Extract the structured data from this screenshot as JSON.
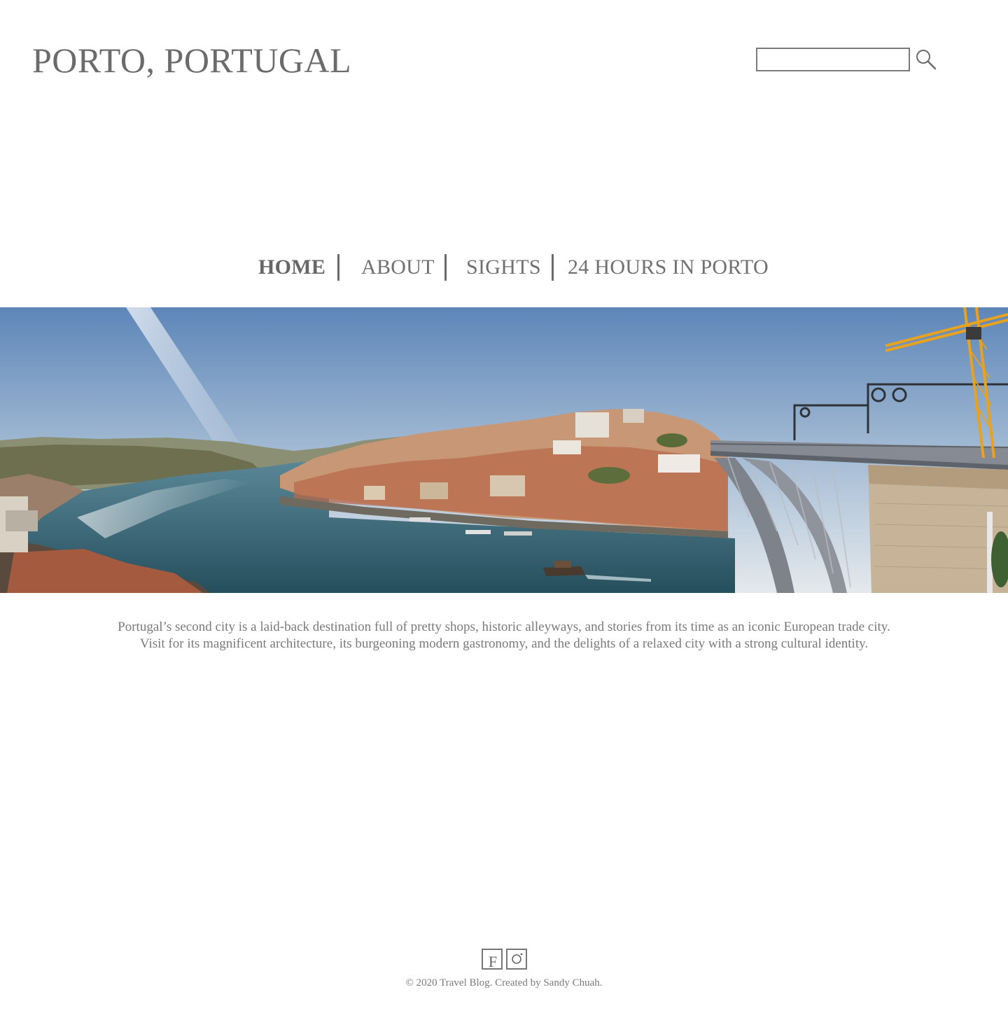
{
  "header": {
    "site_title": "PORTO, PORTUGAL",
    "search": {
      "placeholder": "",
      "value": "",
      "button_icon": "search-icon"
    }
  },
  "nav": {
    "items": [
      {
        "label": "HOME",
        "active": true
      },
      {
        "label": "ABOUT",
        "active": false
      },
      {
        "label": "SIGHTS",
        "active": false
      },
      {
        "label": "24 HOURS IN PORTO",
        "active": false
      }
    ]
  },
  "hero": {
    "description": "Panoramic photo of the Douro river in Porto with the Dom Luís I bridge and a yellow crane"
  },
  "intro": {
    "text": "Portugal’s second city is a laid-back destination full of pretty shops, historic alleyways, and stories from its time as an iconic European trade city. Visit for its magnificent architecture, its burgeoning modern gastronomy, and the delights of a relaxed city with a strong cultural identity."
  },
  "footer": {
    "social": [
      {
        "name": "facebook",
        "icon": "facebook-icon",
        "glyph": "F"
      },
      {
        "name": "instagram",
        "icon": "instagram-icon"
      }
    ],
    "copyright": "© 2020 Travel Blog.  Created by Sandy Chuah."
  },
  "colors": {
    "text": "#6b6b6b",
    "sky_top": "#5f86b7",
    "sky_bottom": "#dfe6ea",
    "river": "#3f6a79",
    "bridge": "#8b8f98",
    "crane": "#e9a21d",
    "roofs": "#b8573a"
  }
}
